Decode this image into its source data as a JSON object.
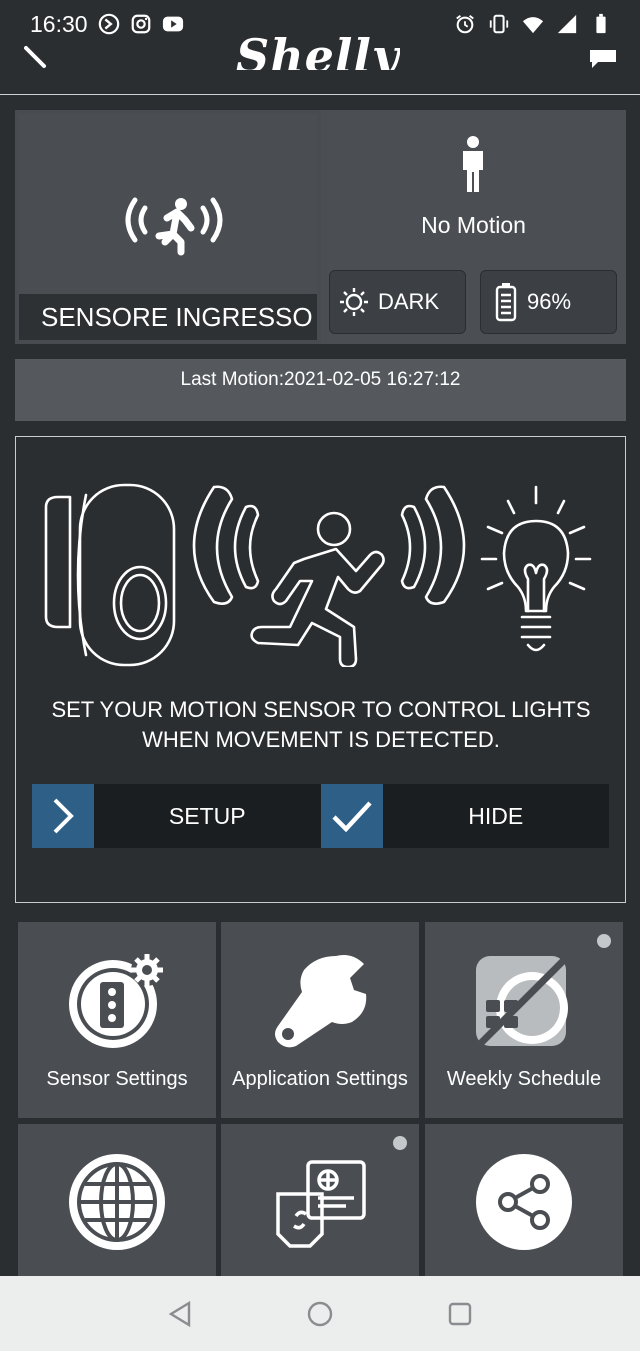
{
  "status_bar": {
    "time": "16:30"
  },
  "app_bar": {
    "logo_text": "Shelly"
  },
  "device": {
    "name": "SENSORE INGRESSO",
    "motion_status": "No Motion",
    "light_status": "DARK",
    "battery": "96%",
    "last_motion": "Last Motion:2021-02-05 16:27:12"
  },
  "setup_panel": {
    "text": "SET YOUR MOTION SENSOR TO CONTROL LIGHTS WHEN MOVEMENT IS DETECTED.",
    "setup_label": "SETUP",
    "hide_label": "HIDE"
  },
  "grid": {
    "sensor_settings": "Sensor Settings",
    "application_settings": "Application Settings",
    "weekly_schedule": "Weekly Schedule"
  },
  "colors": {
    "background": "#2b2e31",
    "accent": "#2e5f86",
    "tile": "#4a4e52"
  }
}
